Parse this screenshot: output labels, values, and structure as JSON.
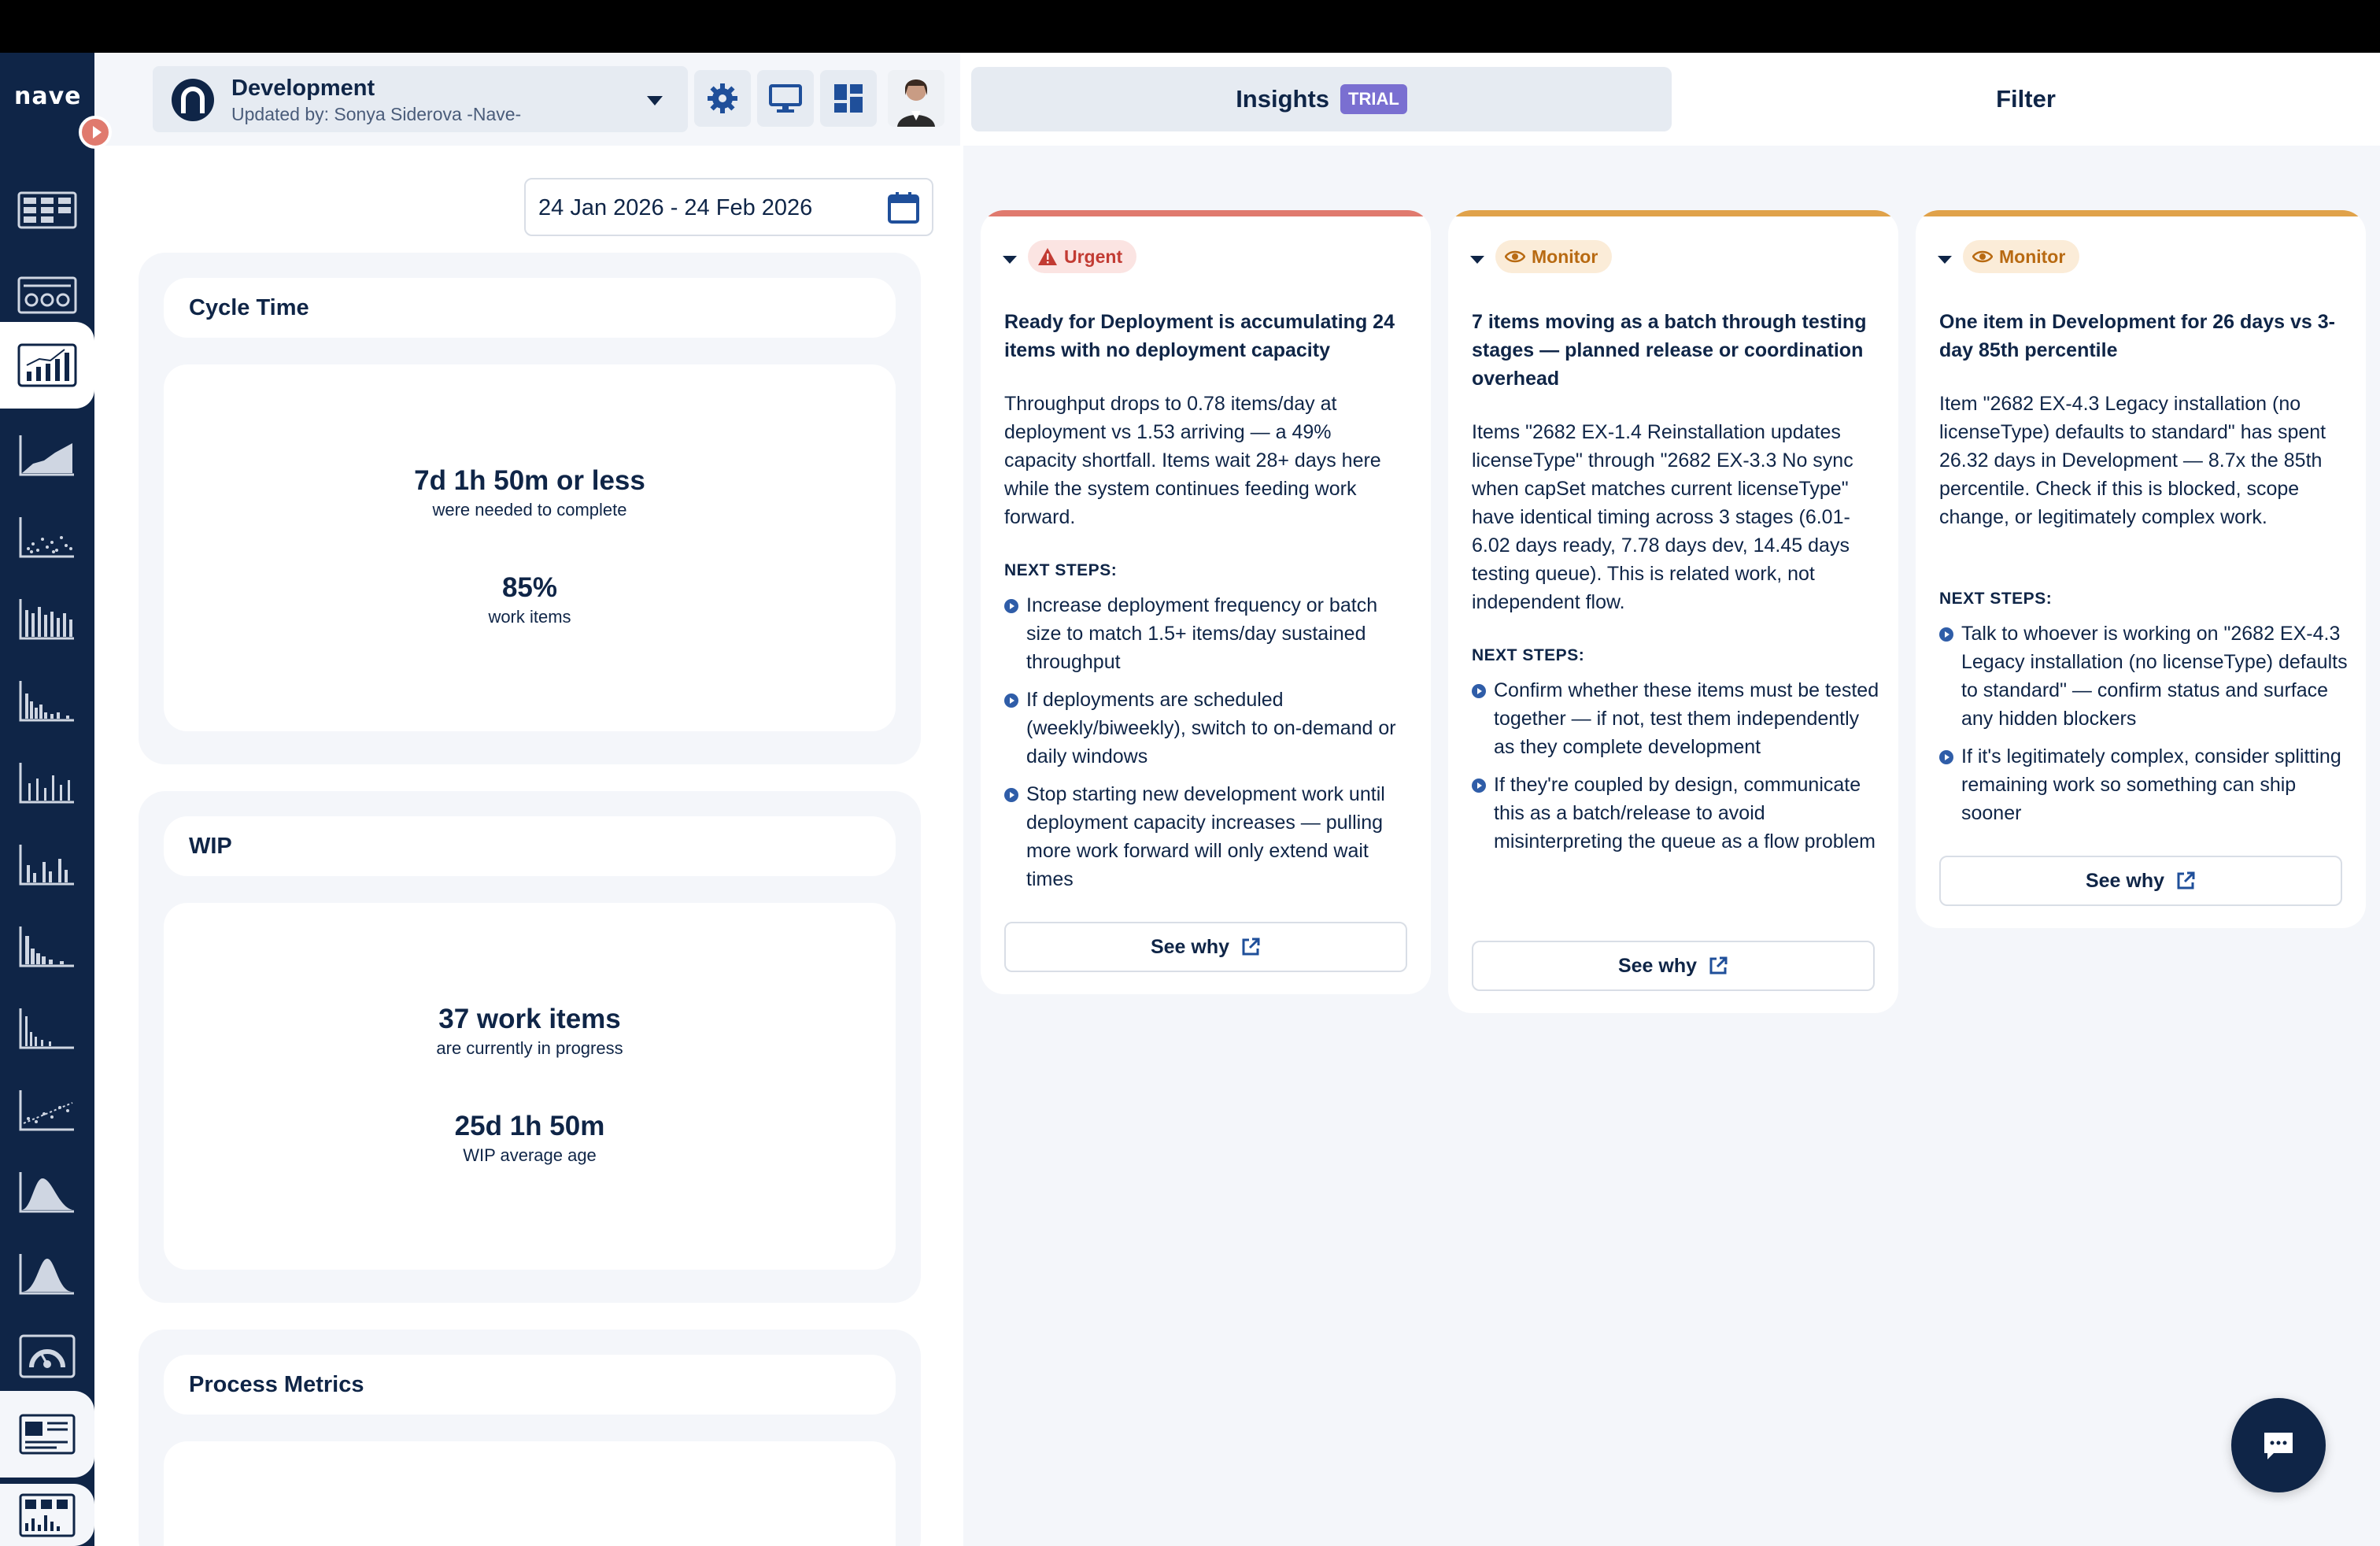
{
  "app": {
    "logo_text": "nave"
  },
  "header": {
    "board_title": "Development",
    "board_subtitle": "Updated by: Sonya Siderova -Nave-"
  },
  "date_range": {
    "value": "24 Jan 2026 - 24 Feb 2026"
  },
  "sidebar": {
    "items": [
      {
        "icon": "kanban-board-icon"
      },
      {
        "icon": "flow-board-icon"
      },
      {
        "icon": "analytics-chart-icon",
        "active": true
      },
      {
        "icon": "cumulative-flow-icon"
      },
      {
        "icon": "scatter-plot-icon"
      },
      {
        "icon": "throughput-bars-icon"
      },
      {
        "icon": "histogram-icon"
      },
      {
        "icon": "run-chart-icon"
      },
      {
        "icon": "distribution-bars-icon"
      },
      {
        "icon": "aging-histogram-icon"
      },
      {
        "icon": "sparse-histogram-icon"
      },
      {
        "icon": "trend-scatter-icon"
      },
      {
        "icon": "probability-curve-icon"
      },
      {
        "icon": "bell-curve-icon"
      },
      {
        "icon": "gauge-icon"
      },
      {
        "icon": "dashboard-report-icon"
      },
      {
        "icon": "metrics-report-icon"
      }
    ]
  },
  "panels": {
    "cycle_time": {
      "title": "Cycle Time",
      "value": "7d 1h 50m or less",
      "value_caption": "were needed to complete",
      "percentile": "85%",
      "percentile_caption": "work items"
    },
    "wip": {
      "title": "WIP",
      "count": "37 work items",
      "count_caption": "are currently in progress",
      "age": "25d 1h 50m",
      "age_caption": "WIP average age"
    },
    "process_metrics": {
      "title": "Process Metrics"
    }
  },
  "tabs": {
    "insights_label": "Insights",
    "trial_badge": "TRIAL",
    "filter_label": "Filter"
  },
  "insights": [
    {
      "severity": "Urgent",
      "accent": "#e07a6e",
      "title": "Ready for Deployment is accumulating 24 items with no deployment capacity",
      "description": "Throughput drops to 0.78 items/day at deployment vs 1.53 arriving — a 49% capacity shortfall. Items wait 28+ days here while the system continues feeding work forward.",
      "next_steps_label": "NEXT STEPS:",
      "steps": [
        "Increase deployment frequency or batch size to match 1.5+ items/day sustained throughput",
        "If deployments are scheduled (weekly/biweekly), switch to on-demand or daily windows",
        "Stop starting new development work until deployment capacity increases — pulling more work forward will only extend wait times"
      ],
      "see_why": "See why"
    },
    {
      "severity": "Monitor",
      "accent": "#e0a24a",
      "title": "7 items moving as a batch through testing stages — planned release or coordination overhead",
      "description": "Items \"2682 EX-1.4 Reinstallation updates licenseType\" through \"2682 EX-3.3 No sync when capSet matches current licenseType\" have identical timing across 3 stages (6.01-6.02 days ready, 7.78 days dev, 14.45 days testing queue). This is related work, not independent flow.",
      "next_steps_label": "NEXT STEPS:",
      "steps": [
        "Confirm whether these items must be tested together — if not, test them independently as they complete development",
        "If they're coupled by design, communicate this as a batch/release to avoid misinterpreting the queue as a flow problem"
      ],
      "see_why": "See why"
    },
    {
      "severity": "Monitor",
      "accent": "#e0a24a",
      "title": "One item in Development for 26 days vs 3-day 85th percentile",
      "description": "Item \"2682 EX-4.3 Legacy installation (no licenseType) defaults to standard\" has spent 26.32 days in Development — 8.7x the 85th percentile. Check if this is blocked, scope change, or legitimately complex work.",
      "next_steps_label": "NEXT STEPS:",
      "steps": [
        "Talk to whoever is working on \"2682 EX-4.3 Legacy installation (no licenseType) defaults to standard\" — confirm status and surface any hidden blockers",
        "If it's legitimately complex, consider splitting remaining work so something can ship sooner"
      ],
      "see_why": "See why"
    }
  ]
}
